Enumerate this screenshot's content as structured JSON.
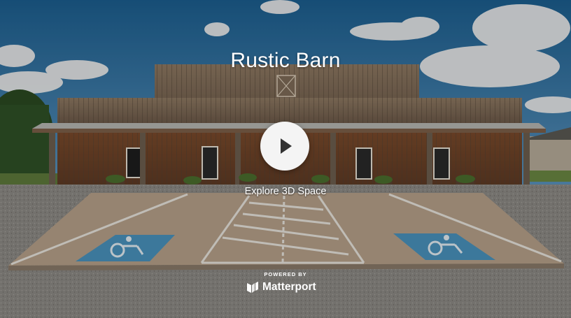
{
  "tour": {
    "title": "Rustic Barn",
    "cta_label": "Explore 3D Space",
    "powered_by": "POWERED BY",
    "brand": "Matterport"
  },
  "icons": {
    "play": "play-icon",
    "brand_logo": "matterport-logo-icon",
    "accessible_parking": "wheelchair-icon"
  },
  "colors": {
    "play_button_bg": "#f4f4f4",
    "play_glyph": "#333333",
    "accessible_blue": "#4a93bd",
    "text": "#ffffff"
  }
}
